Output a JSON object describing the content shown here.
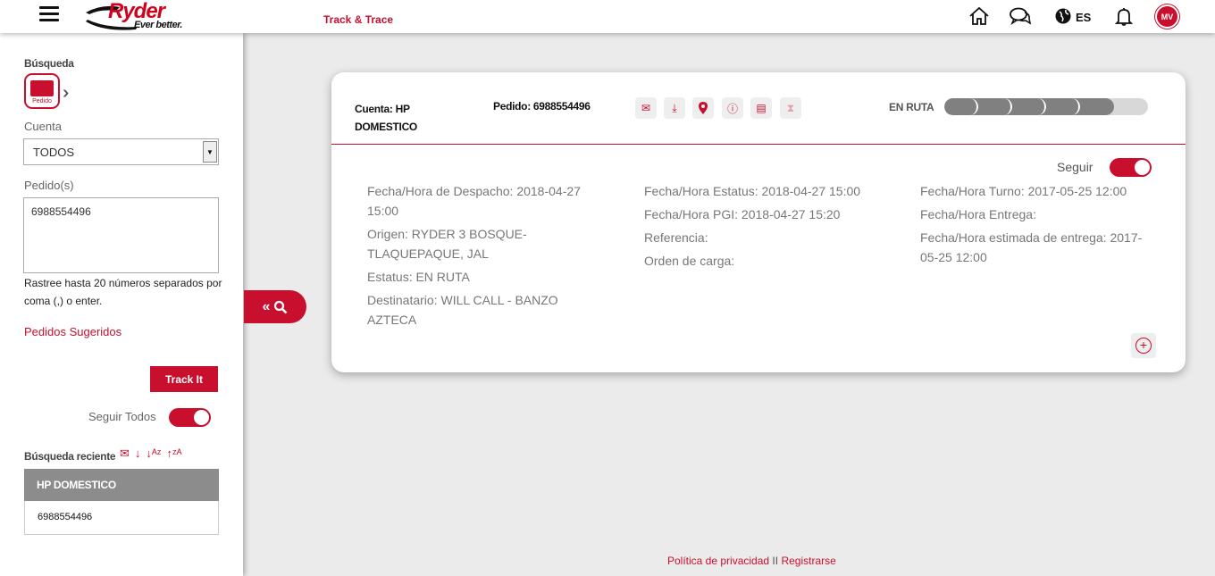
{
  "header": {
    "brand": "Ryder",
    "tagline": "Ever better.",
    "app_title": "Track & Trace",
    "language": "ES",
    "avatar_initials": "MV"
  },
  "sidebar": {
    "search_label": "Búsqueda",
    "pedido_button": "Pedido",
    "account_label": "Cuenta",
    "account_value": "TODOS",
    "orders_label": "Pedido(s)",
    "orders_value": "6988554496",
    "hint": "Rastree hasta 20 números separados por coma (,) o enter.",
    "suggested_link": "Pedidos Sugeridos",
    "track_button": "Track It",
    "follow_all_label": "Seguir Todos",
    "follow_all_on": true,
    "recent_label": "Búsqueda reciente",
    "recent_group": "HP DOMESTICO",
    "recent_items": [
      "6988554496"
    ]
  },
  "card": {
    "account": "Cuenta: HP DOMESTICO",
    "order": "Pedido: 6988554496",
    "status": "EN RUTA",
    "progress_steps_total": 6,
    "progress_steps_done": 5,
    "follow_label": "Seguir",
    "follow_on": true,
    "col1": [
      "Fecha/Hora de Despacho: 2018-04-27 15:00",
      "Origen: RYDER 3 BOSQUE-TLAQUEPAQUE, JAL",
      "Estatus: EN RUTA",
      "Destinatario: WILL CALL - BANZO AZTECA"
    ],
    "col2": [
      "Fecha/Hora Estatus: 2018-04-27 15:00",
      "Fecha/Hora PGI: 2018-04-27 15:20",
      "Referencia:",
      "Orden de carga:"
    ],
    "col3": [
      "Fecha/Hora Turno: 2017-05-25 12:00",
      "Fecha/Hora Entrega:",
      "Fecha/Hora estimada de entrega: 2017-05-25 12:00"
    ]
  },
  "footer": {
    "privacy": "Política de privacidad",
    "separator": "II",
    "register": "Registrarse"
  },
  "colors": {
    "accent": "#c8102e",
    "progress_done": "#808080",
    "progress_rest": "#d8d8d8"
  }
}
